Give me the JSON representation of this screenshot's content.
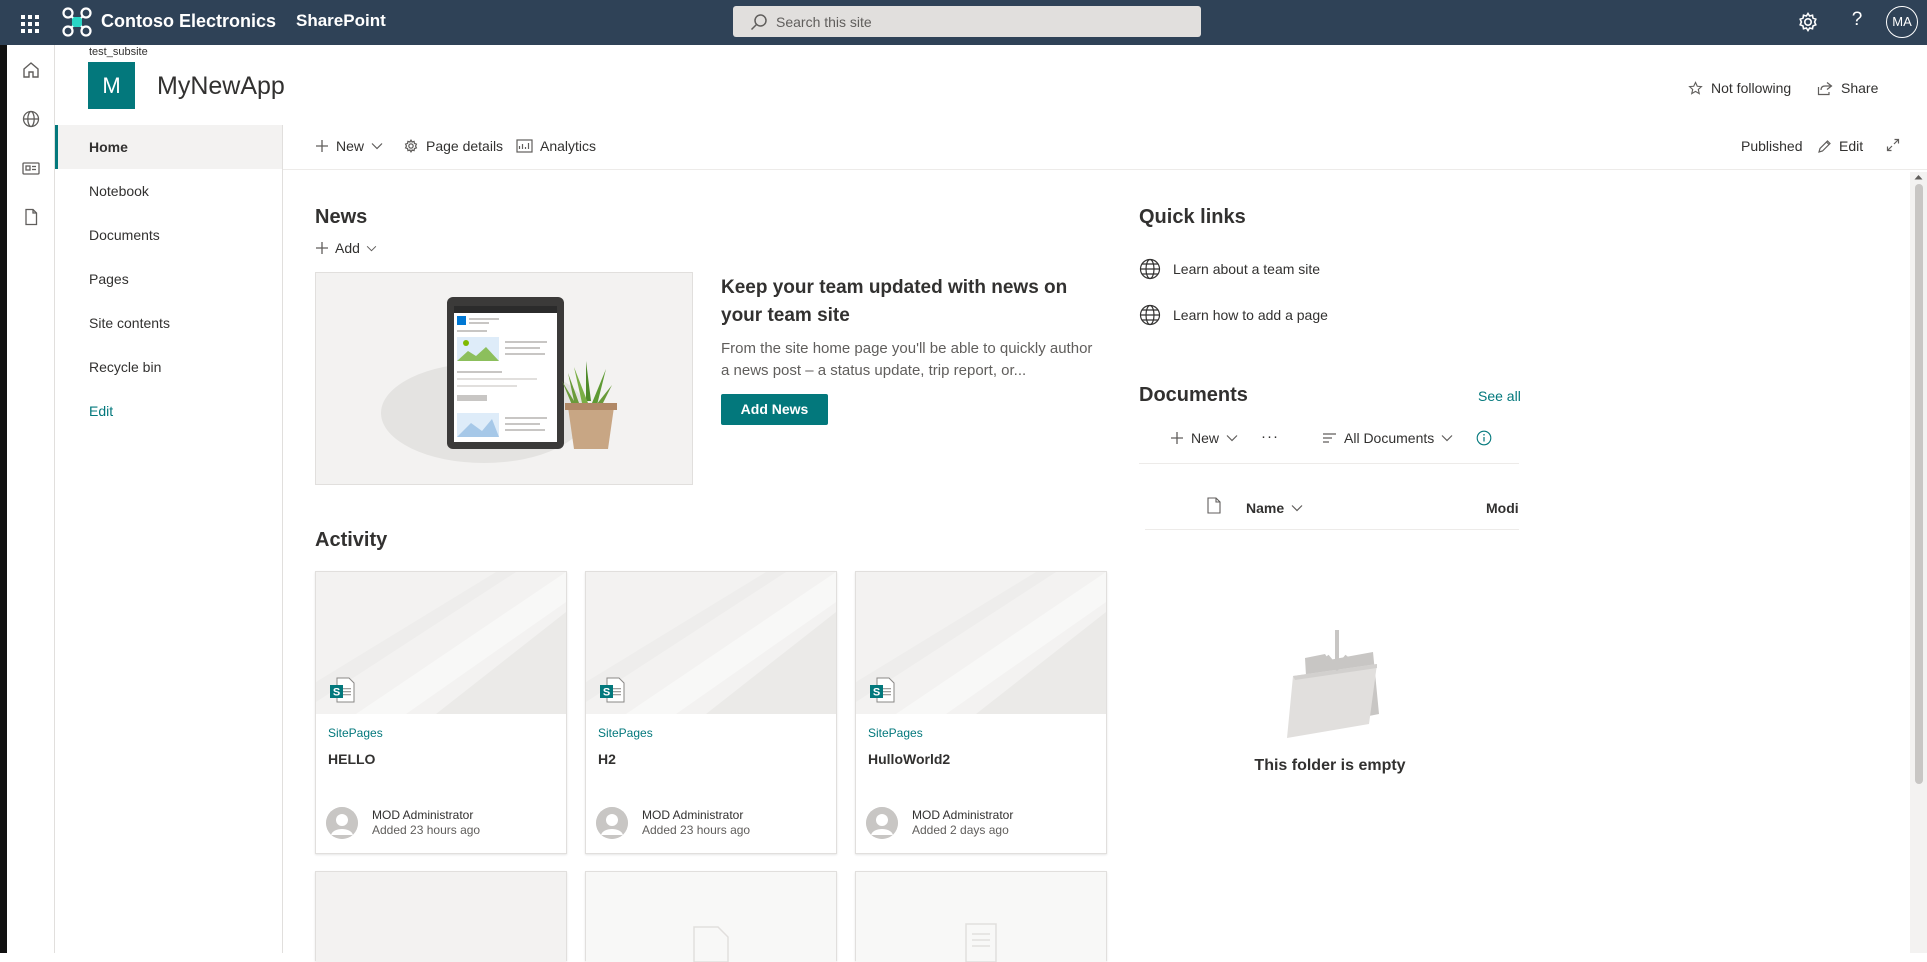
{
  "suite_bar": {
    "brand": "Contoso Electronics",
    "app": "SharePoint",
    "search_placeholder": "Search this site",
    "avatar_initials": "MA",
    "help_label": "?",
    "colors": {
      "bar": "#2f4257",
      "accent": "#03787c"
    }
  },
  "site": {
    "subsite": "test_subsite",
    "logo_letter": "M",
    "title": "MyNewApp",
    "follow_label": "Not following",
    "share_label": "Share"
  },
  "left_nav": {
    "items": [
      {
        "label": "Home"
      },
      {
        "label": "Notebook"
      },
      {
        "label": "Documents"
      },
      {
        "label": "Pages"
      },
      {
        "label": "Site contents"
      },
      {
        "label": "Recycle bin"
      },
      {
        "label": "Edit"
      }
    ]
  },
  "command_bar": {
    "new_label": "New",
    "page_details_label": "Page details",
    "analytics_label": "Analytics",
    "status": "Published",
    "edit_label": "Edit"
  },
  "news": {
    "title": "News",
    "add_label": "Add",
    "heading": "Keep your team updated with news on your team site",
    "description": "From the site home page you'll be able to quickly author a news post – a status update, trip report, or...",
    "button": "Add News"
  },
  "activity": {
    "title": "Activity",
    "cards": [
      {
        "source": "SitePages",
        "title": "HELLO",
        "author": "MOD Administrator",
        "when": "Added 23 hours ago"
      },
      {
        "source": "SitePages",
        "title": "H2",
        "author": "MOD Administrator",
        "when": "Added 23 hours ago"
      },
      {
        "source": "SitePages",
        "title": "HulloWorld2",
        "author": "MOD Administrator",
        "when": "Added 2 days ago"
      }
    ]
  },
  "quick_links": {
    "title": "Quick links",
    "items": [
      {
        "label": "Learn about a team site"
      },
      {
        "label": "Learn how to add a page"
      }
    ]
  },
  "documents": {
    "title": "Documents",
    "see_all": "See all",
    "new_label": "New",
    "more_label": "···",
    "view_label": "All Documents",
    "col_name": "Name",
    "col_modified": "Modi",
    "empty_text": "This folder is empty"
  }
}
